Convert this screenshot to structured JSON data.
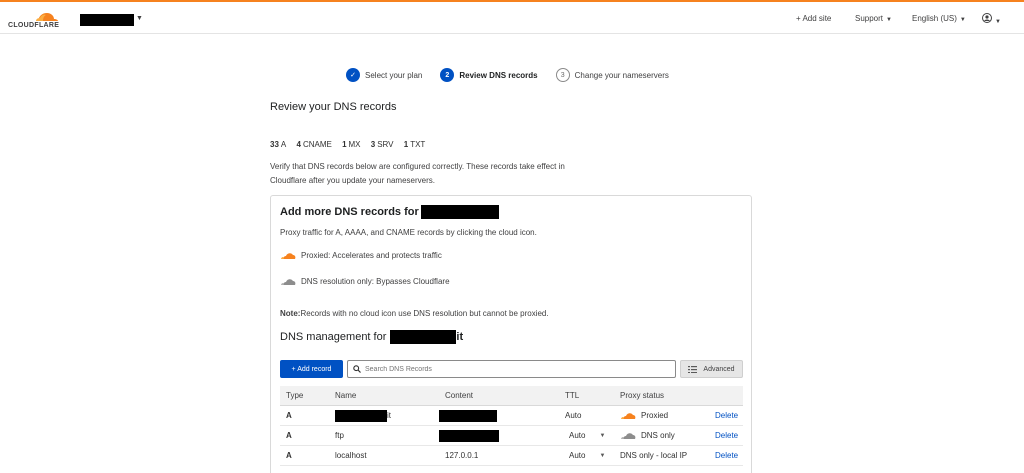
{
  "header": {
    "logo_text": "CLOUDFLARE",
    "nav": {
      "add_site": "+ Add site",
      "support": "Support",
      "language": "English (US)"
    }
  },
  "stepper": [
    {
      "label": "Select your plan",
      "state": "done",
      "marker": "✓"
    },
    {
      "label": "Review DNS records",
      "state": "active",
      "marker": "2"
    },
    {
      "label": "Change your nameservers",
      "state": "todo",
      "marker": "3"
    }
  ],
  "page_title": "Review your DNS records",
  "record_counts": [
    {
      "count": "33",
      "type": "A"
    },
    {
      "count": "4",
      "type": "CNAME"
    },
    {
      "count": "1",
      "type": "MX"
    },
    {
      "count": "3",
      "type": "SRV"
    },
    {
      "count": "1",
      "type": "TXT"
    }
  ],
  "verify_text": "Verify that DNS records below are configured correctly. These records take effect in Cloudflare after you update your nameservers.",
  "card": {
    "title": "Add more DNS records for",
    "proxy_hint": "Proxy traffic for A, AAAA, and CNAME records by clicking the cloud icon.",
    "proxied_legend": "Proxied: Accelerates and protects traffic",
    "dns_only_legend": "DNS resolution only: Bypasses Cloudflare",
    "note_label": "Note:",
    "note_text": " Records with no cloud icon use DNS resolution but cannot be proxied.",
    "dns_mgmt_title": "DNS management for",
    "dns_mgmt_suffix": "it"
  },
  "toolbar": {
    "add_record": "+ Add record",
    "search_placeholder": "Search DNS Records",
    "advanced": "Advanced"
  },
  "table": {
    "headers": [
      "Type",
      "Name",
      "Content",
      "TTL",
      "Proxy status"
    ],
    "rows": [
      {
        "type": "A",
        "name_suffix": "it",
        "name": "",
        "content": "",
        "ttl": "Auto",
        "proxy": "Proxied",
        "proxy_state": "proxied",
        "action": "Delete"
      },
      {
        "type": "A",
        "name_suffix": "",
        "name": "ftp",
        "content": "",
        "ttl": "Auto",
        "proxy": "DNS only",
        "proxy_state": "dns-only",
        "action": "Delete"
      },
      {
        "type": "A",
        "name_suffix": "",
        "name": "localhost",
        "content": "127.0.0.1",
        "ttl": "Auto",
        "proxy": "DNS only - local IP",
        "proxy_state": "none",
        "action": "Delete"
      }
    ]
  },
  "colors": {
    "brand_orange": "#f6821f",
    "primary_blue": "#0051c3",
    "dns_only_gray": "#8d8d8d"
  }
}
